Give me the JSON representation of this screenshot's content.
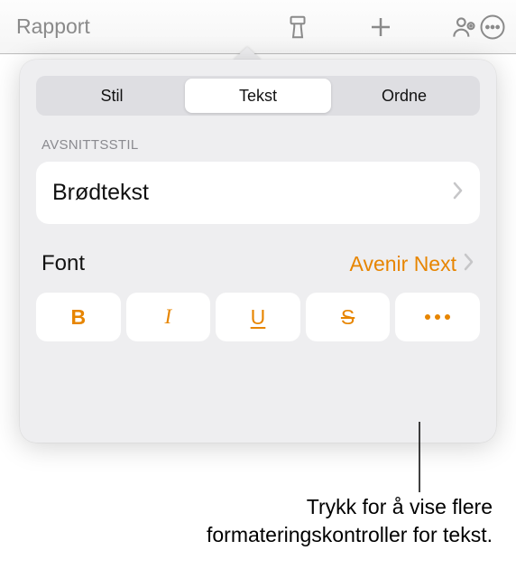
{
  "toolbar": {
    "title": "Rapport"
  },
  "tabs": {
    "stil": "Stil",
    "tekst": "Tekst",
    "ordne": "Ordne"
  },
  "paragraph_style": {
    "label": "AVSNITTSSTIL",
    "value": "Brødtekst"
  },
  "font": {
    "label": "Font",
    "value": "Avenir Next"
  },
  "style_buttons": {
    "bold": "B",
    "italic": "I",
    "underline": "U",
    "strike": "S"
  },
  "callout": {
    "line1": "Trykk for å vise flere",
    "line2": "formateringskontroller for tekst."
  }
}
